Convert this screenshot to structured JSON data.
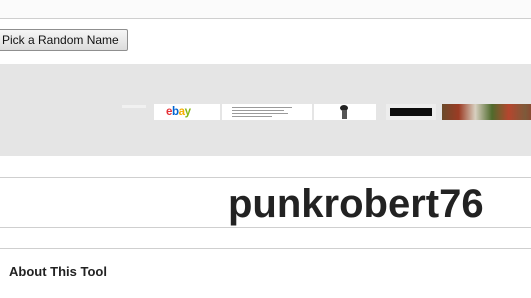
{
  "controls": {
    "pick_button_label": "Pick a Random Name"
  },
  "ad_banner": {
    "tiles": [
      {
        "name": "ebay-logo",
        "text_parts": [
          "e",
          "b",
          "a",
          "y"
        ]
      },
      {
        "name": "text-ad"
      },
      {
        "name": "person-thumbnail"
      },
      {
        "name": "tv-thumbnail"
      },
      {
        "name": "photo-thumbnail"
      }
    ]
  },
  "result": {
    "name": "punkrobert76"
  },
  "section": {
    "about_heading": "About This Tool"
  }
}
